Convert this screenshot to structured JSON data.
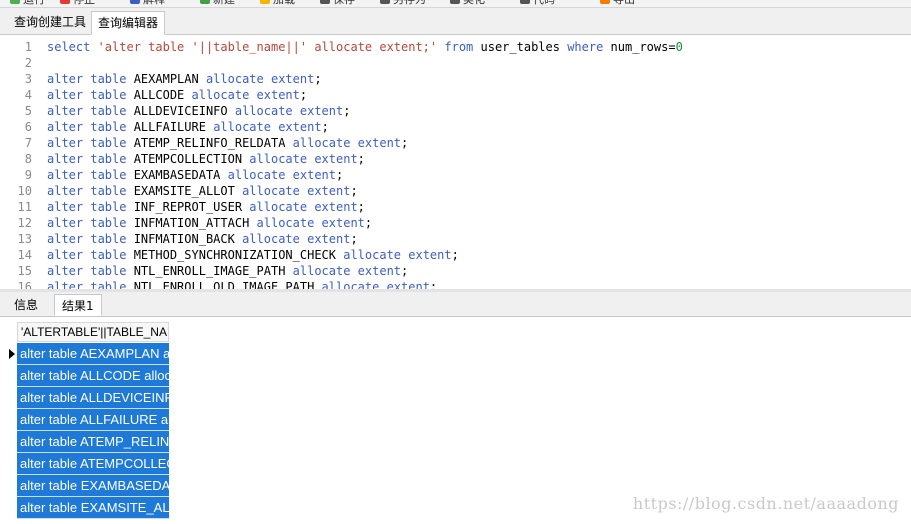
{
  "toolbar": {
    "items": [
      {
        "label": "运行",
        "icon": "run-icon",
        "color": "#4caf50"
      },
      {
        "label": "停止",
        "icon": "stop-icon",
        "color": "#e53935"
      },
      {
        "label": "解释",
        "icon": "explain-icon",
        "color": "#3c5fbf"
      },
      {
        "label": "新建",
        "icon": "new-icon",
        "color": "#43a047"
      },
      {
        "label": "加载",
        "icon": "load-icon",
        "color": "#f5b400"
      },
      {
        "label": "保存",
        "icon": "save-icon",
        "color": "#555555"
      },
      {
        "label": "另存为",
        "icon": "save-as-icon",
        "color": "#555555"
      },
      {
        "label": "美化",
        "icon": "beautify-icon",
        "color": "#555555"
      },
      {
        "label": "代码",
        "icon": "code-icon",
        "color": "#555555"
      },
      {
        "label": "导出",
        "icon": "export-icon",
        "color": "#f57c00"
      }
    ]
  },
  "top_tabs": [
    {
      "label": "查询创建工具",
      "active": false
    },
    {
      "label": "查询编辑器",
      "active": true
    }
  ],
  "editor": {
    "lines": [
      {
        "n": "1",
        "tokens": [
          [
            "kw",
            "select "
          ],
          [
            "str",
            "'alter table '||table_name||' allocate extent;'"
          ],
          [
            "plain",
            " "
          ],
          [
            "kw",
            "from"
          ],
          [
            "plain",
            " user_tables "
          ],
          [
            "kw",
            "where"
          ],
          [
            "plain",
            " num_rows="
          ],
          [
            "num",
            "0"
          ]
        ]
      },
      {
        "n": "2",
        "tokens": []
      },
      {
        "n": "3",
        "tokens": [
          [
            "kw",
            "alter table "
          ],
          [
            "plain",
            "AEXAMPLAN "
          ],
          [
            "kw",
            "allocate extent"
          ],
          [
            "plain",
            ";"
          ]
        ]
      },
      {
        "n": "4",
        "tokens": [
          [
            "kw",
            "alter table "
          ],
          [
            "plain",
            "ALLCODE "
          ],
          [
            "kw",
            "allocate extent"
          ],
          [
            "plain",
            ";"
          ]
        ]
      },
      {
        "n": "5",
        "tokens": [
          [
            "kw",
            "alter table "
          ],
          [
            "plain",
            "ALLDEVICEINFO "
          ],
          [
            "kw",
            "allocate extent"
          ],
          [
            "plain",
            ";"
          ]
        ]
      },
      {
        "n": "6",
        "tokens": [
          [
            "kw",
            "alter table "
          ],
          [
            "plain",
            "ALLFAILURE "
          ],
          [
            "kw",
            "allocate extent"
          ],
          [
            "plain",
            ";"
          ]
        ]
      },
      {
        "n": "7",
        "tokens": [
          [
            "kw",
            "alter table "
          ],
          [
            "plain",
            "ATEMP_RELINFO_RELDATA "
          ],
          [
            "kw",
            "allocate extent"
          ],
          [
            "plain",
            ";"
          ]
        ]
      },
      {
        "n": "8",
        "tokens": [
          [
            "kw",
            "alter table "
          ],
          [
            "plain",
            "ATEMPCOLLECTION "
          ],
          [
            "kw",
            "allocate extent"
          ],
          [
            "plain",
            ";"
          ]
        ]
      },
      {
        "n": "9",
        "tokens": [
          [
            "kw",
            "alter table "
          ],
          [
            "plain",
            "EXAMBASEDATA "
          ],
          [
            "kw",
            "allocate extent"
          ],
          [
            "plain",
            ";"
          ]
        ]
      },
      {
        "n": "10",
        "tokens": [
          [
            "kw",
            "alter table "
          ],
          [
            "plain",
            "EXAMSITE_ALLOT "
          ],
          [
            "kw",
            "allocate extent"
          ],
          [
            "plain",
            ";"
          ]
        ]
      },
      {
        "n": "11",
        "tokens": [
          [
            "kw",
            "alter table "
          ],
          [
            "plain",
            "INF_REPROT_USER "
          ],
          [
            "kw",
            "allocate extent"
          ],
          [
            "plain",
            ";"
          ]
        ]
      },
      {
        "n": "12",
        "tokens": [
          [
            "kw",
            "alter table "
          ],
          [
            "plain",
            "INFMATION_ATTACH "
          ],
          [
            "kw",
            "allocate extent"
          ],
          [
            "plain",
            ";"
          ]
        ]
      },
      {
        "n": "13",
        "tokens": [
          [
            "kw",
            "alter table "
          ],
          [
            "plain",
            "INFMATION_BACK "
          ],
          [
            "kw",
            "allocate extent"
          ],
          [
            "plain",
            ";"
          ]
        ]
      },
      {
        "n": "14",
        "tokens": [
          [
            "kw",
            "alter table "
          ],
          [
            "plain",
            "METHOD_SYNCHRONIZATION_CHECK "
          ],
          [
            "kw",
            "allocate extent"
          ],
          [
            "plain",
            ";"
          ]
        ]
      },
      {
        "n": "15",
        "tokens": [
          [
            "kw",
            "alter table "
          ],
          [
            "plain",
            "NTL_ENROLL_IMAGE_PATH "
          ],
          [
            "kw",
            "allocate extent"
          ],
          [
            "plain",
            ";"
          ]
        ]
      },
      {
        "n": "16",
        "tokens": [
          [
            "kw",
            "alter table "
          ],
          [
            "plain",
            "NTL_ENROLL_OLD_IMAGE_PATH "
          ],
          [
            "kw",
            "allocate extent"
          ],
          [
            "plain",
            ";"
          ]
        ]
      }
    ]
  },
  "bottom_tabs": [
    {
      "label": "信息",
      "active": false
    },
    {
      "label": "结果1",
      "active": true
    }
  ],
  "results": {
    "column_header": "'ALTERTABLE'||TABLE_NAME||'ALLOCATEEXTENT;'",
    "rows": [
      "alter table AEXAMPLAN allocate extent;",
      "alter table ALLCODE allocate extent;",
      "alter table ALLDEVICEINFO allocate extent;",
      "alter table ALLFAILURE allocate extent;",
      "alter table ATEMP_RELINFO_RELDATA allocate extent;",
      "alter table ATEMPCOLLECTION allocate extent;",
      "alter table EXAMBASEDATA allocate extent;",
      "alter table EXAMSITE_ALLOT allocate extent;"
    ],
    "selected_color": "#1e7ad6"
  },
  "watermark": "https://blog.csdn.net/aaaadong"
}
